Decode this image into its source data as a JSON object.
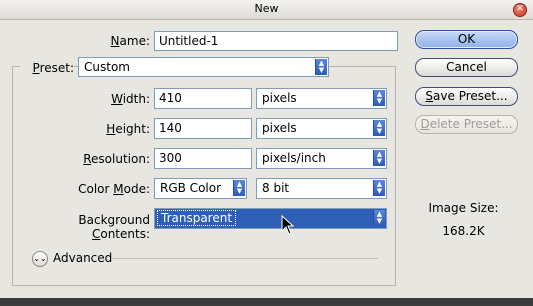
{
  "window": {
    "title": "New",
    "close_icon": "close-icon"
  },
  "name": {
    "label_pre": "",
    "label_u": "N",
    "label_post": "ame:",
    "value": "Untitled-1"
  },
  "preset": {
    "label_pre": "",
    "label_u": "P",
    "label_post": "reset:",
    "value": "Custom"
  },
  "width": {
    "label_pre": "",
    "label_u": "W",
    "label_post": "idth:",
    "value": "410",
    "unit": "pixels"
  },
  "height": {
    "label_pre": "",
    "label_u": "H",
    "label_post": "eight:",
    "value": "140",
    "unit": "pixels"
  },
  "resolution": {
    "label_pre": "",
    "label_u": "R",
    "label_post": "esolution:",
    "value": "300",
    "unit": "pixels/inch"
  },
  "color_mode": {
    "label_pre": "Color ",
    "label_u": "M",
    "label_post": "ode:",
    "value": "RGB Color",
    "depth": "8 bit"
  },
  "background": {
    "label_pre": "Background ",
    "label_u": "C",
    "label_post": "ontents:",
    "value": "Transparent"
  },
  "advanced": {
    "label": "Advanced"
  },
  "buttons": {
    "ok": "OK",
    "cancel": "Cancel",
    "save_pre": "",
    "save_u": "S",
    "save_post": "ave Preset...",
    "delete_pre": "",
    "delete_u": "D",
    "delete_post": "elete Preset..."
  },
  "image_size": {
    "label": "Image Size:",
    "value": "168.2K"
  },
  "colors": {
    "accent": "#2f5fb5",
    "dialog_bg": "#e8e6e0",
    "field_border": "#7f9db9"
  }
}
